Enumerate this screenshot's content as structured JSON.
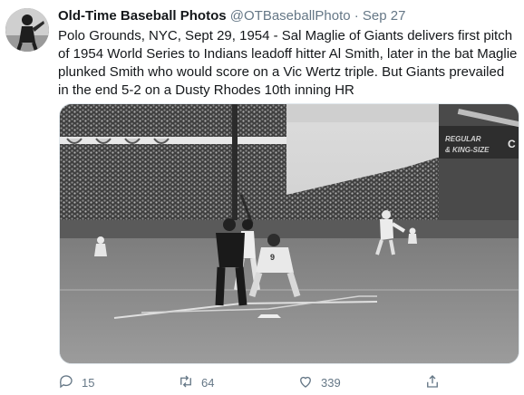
{
  "tweet": {
    "author_name": "Old-Time Baseball Photos",
    "handle": "@OTBaseballPhoto",
    "separator": "·",
    "time": "Sep 27",
    "text": "Polo Grounds, NYC, Sept 29, 1954 - Sal Maglie of Giants delivers first pitch of 1954 World Series to Indians leadoff hitter Al Smith, later in the bat Maglie plunked Smith who would score on a Vic Wertz triple. But Giants prevailed in the end 5-2 on a Dusty Rhodes 10th inning HR"
  },
  "media": {
    "sign_text_1": "REGULAR",
    "sign_text_2": "& KING-SIZE",
    "sign_letter": "C",
    "umpire_number": "9"
  },
  "actions": {
    "reply_count": "15",
    "retweet_count": "64",
    "like_count": "339"
  },
  "colors": {
    "text": "#14171a",
    "secondary": "#657786"
  },
  "icons": [
    "reply-icon",
    "retweet-icon",
    "like-icon",
    "share-icon"
  ]
}
